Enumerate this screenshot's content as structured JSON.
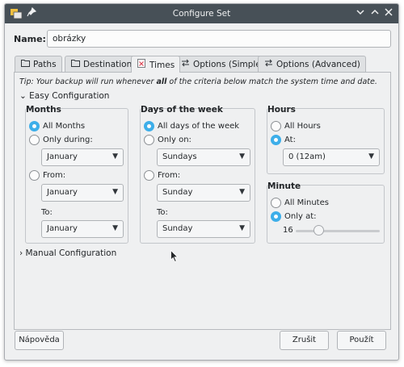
{
  "window": {
    "title": "Configure Set"
  },
  "name_field": {
    "label": "Name:",
    "value": "obrázky"
  },
  "tabs": [
    {
      "label": "Paths",
      "icon": "folder-icon"
    },
    {
      "label": "Destination",
      "icon": "folder-icon"
    },
    {
      "label": "Times",
      "icon": "calendar-icon",
      "active": true
    },
    {
      "label": "Options (Simple)",
      "icon": "arrows-icon"
    },
    {
      "label": "Options (Advanced)",
      "icon": "arrows-icon"
    }
  ],
  "tip": {
    "prefix": "Tip: Your backup will run whenever ",
    "bold": "all",
    "suffix": " of the criteria below match the system time and date."
  },
  "easy_config": {
    "label": "Easy Configuration"
  },
  "manual_config": {
    "label": "Manual Configuration"
  },
  "months": {
    "title": "Months",
    "all_label": "All Months",
    "only_during_label": "Only during:",
    "only_during_value": "January",
    "from_label": "From:",
    "from_value": "January",
    "to_label": "To:",
    "to_value": "January"
  },
  "days": {
    "title": "Days of the week",
    "all_label": "All days of the week",
    "only_on_label": "Only on:",
    "only_on_value": "Sundays",
    "from_label": "From:",
    "from_value": "Sunday",
    "to_label": "To:",
    "to_value": "Sunday"
  },
  "hours": {
    "title": "Hours",
    "all_label": "All Hours",
    "at_label": "At:",
    "at_value": "0 (12am)"
  },
  "minute": {
    "title": "Minute",
    "all_label": "All Minutes",
    "only_at_label": "Only at:",
    "value": "16",
    "slider_fraction": 0.27
  },
  "buttons": {
    "help": "Nápověda",
    "cancel": "Zrušit",
    "apply": "Použít"
  },
  "colors": {
    "accent": "#3daee9",
    "titlebar": "#475057"
  }
}
